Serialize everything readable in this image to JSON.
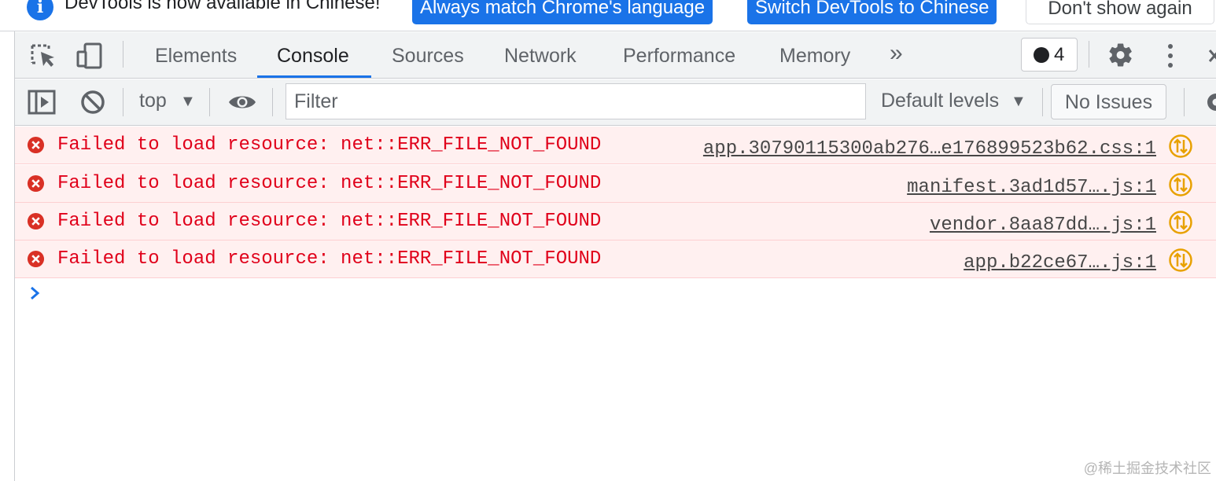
{
  "infobar": {
    "message": "DevTools is now available in Chinese!",
    "btn_match": "Always match Chrome's language",
    "btn_switch": "Switch DevTools to Chinese",
    "btn_dismiss": "Don't show again"
  },
  "tabs": {
    "elements": "Elements",
    "console": "Console",
    "sources": "Sources",
    "network": "Network",
    "performance": "Performance",
    "memory": "Memory",
    "more": "»"
  },
  "badge": {
    "count": "4"
  },
  "console_toolbar": {
    "context": "top",
    "filter_placeholder": "Filter",
    "levels": "Default levels",
    "issues": "No Issues"
  },
  "messages": [
    {
      "text": "Failed to load resource: net::ERR_FILE_NOT_FOUND",
      "source": "app.30790115300ab276…e176899523b62.css:1"
    },
    {
      "text": "Failed to load resource: net::ERR_FILE_NOT_FOUND",
      "source": "manifest.3ad1d57….js:1"
    },
    {
      "text": "Failed to load resource: net::ERR_FILE_NOT_FOUND",
      "source": "vendor.8aa87dd….js:1"
    },
    {
      "text": "Failed to load resource: net::ERR_FILE_NOT_FOUND",
      "source": "app.b22ce67….js:1"
    }
  ],
  "watermark": "@稀土掘金技术社区",
  "colors": {
    "accent": "#1a73e8",
    "error_text": "#e0001a",
    "error_bg": "#fff0f0",
    "error_icon": "#d93025",
    "warning_icon": "#e8a100"
  },
  "icons": {
    "info": "info-icon",
    "inspect": "inspect-element-icon",
    "device": "device-toolbar-icon",
    "settings": "gear-icon",
    "menu": "kebab-menu-icon",
    "sidebar": "show-sidebar-icon",
    "clear": "clear-console-icon",
    "eye": "eye-icon",
    "error": "error-icon",
    "network_request": "network-request-icon",
    "prompt": "chevron-right-icon"
  }
}
